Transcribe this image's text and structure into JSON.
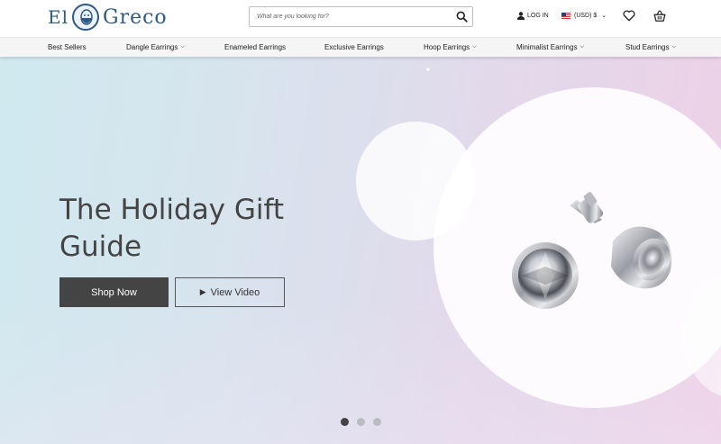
{
  "header": {
    "logo_left": "El",
    "logo_right": "Greco",
    "search_placeholder": "What are you looking for?",
    "login_label": "LOG IN",
    "currency_label": "(USD) $"
  },
  "nav": {
    "items": [
      {
        "label": "Best Sellers",
        "has_dropdown": false
      },
      {
        "label": "Dangle Earrings",
        "has_dropdown": true
      },
      {
        "label": "Enameled Earrings",
        "has_dropdown": false
      },
      {
        "label": "Exclusive Earrings",
        "has_dropdown": false
      },
      {
        "label": "Hoop Earrings",
        "has_dropdown": true
      },
      {
        "label": "Minimalist Earrings",
        "has_dropdown": true
      },
      {
        "label": "Stud Earrings",
        "has_dropdown": true
      }
    ]
  },
  "hero": {
    "headline": "The Holiday Gift Guide",
    "primary_button": "Shop Now",
    "secondary_button": "View Video",
    "slides_total": 3,
    "slide_active": 1
  },
  "colors": {
    "brand": "#2f5a86",
    "button_dark": "#444444",
    "text_dark": "#444444"
  }
}
